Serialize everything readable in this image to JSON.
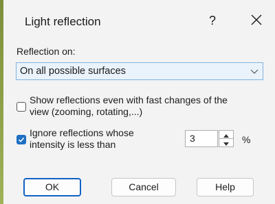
{
  "window": {
    "title": "Light reflection",
    "help_glyph": "?",
    "help_icon": "question-mark-icon",
    "close_icon": "close-icon"
  },
  "reflection": {
    "label": "Reflection on:",
    "selected_option": "On all possible surfaces"
  },
  "options": {
    "fast_changes": {
      "checked": false,
      "line1": "Show reflections even with fast changes of the",
      "line2": "view (zooming, rotating,...)"
    },
    "ignore_low": {
      "checked": true,
      "line1": "Ignore reflections whose",
      "line2": "intensity is less than",
      "value": "3",
      "unit": "%"
    }
  },
  "buttons": {
    "ok": "OK",
    "cancel": "Cancel",
    "help": "Help"
  },
  "colors": {
    "accent": "#1f6fc4",
    "dialog_bg": "#f3f3f3"
  }
}
